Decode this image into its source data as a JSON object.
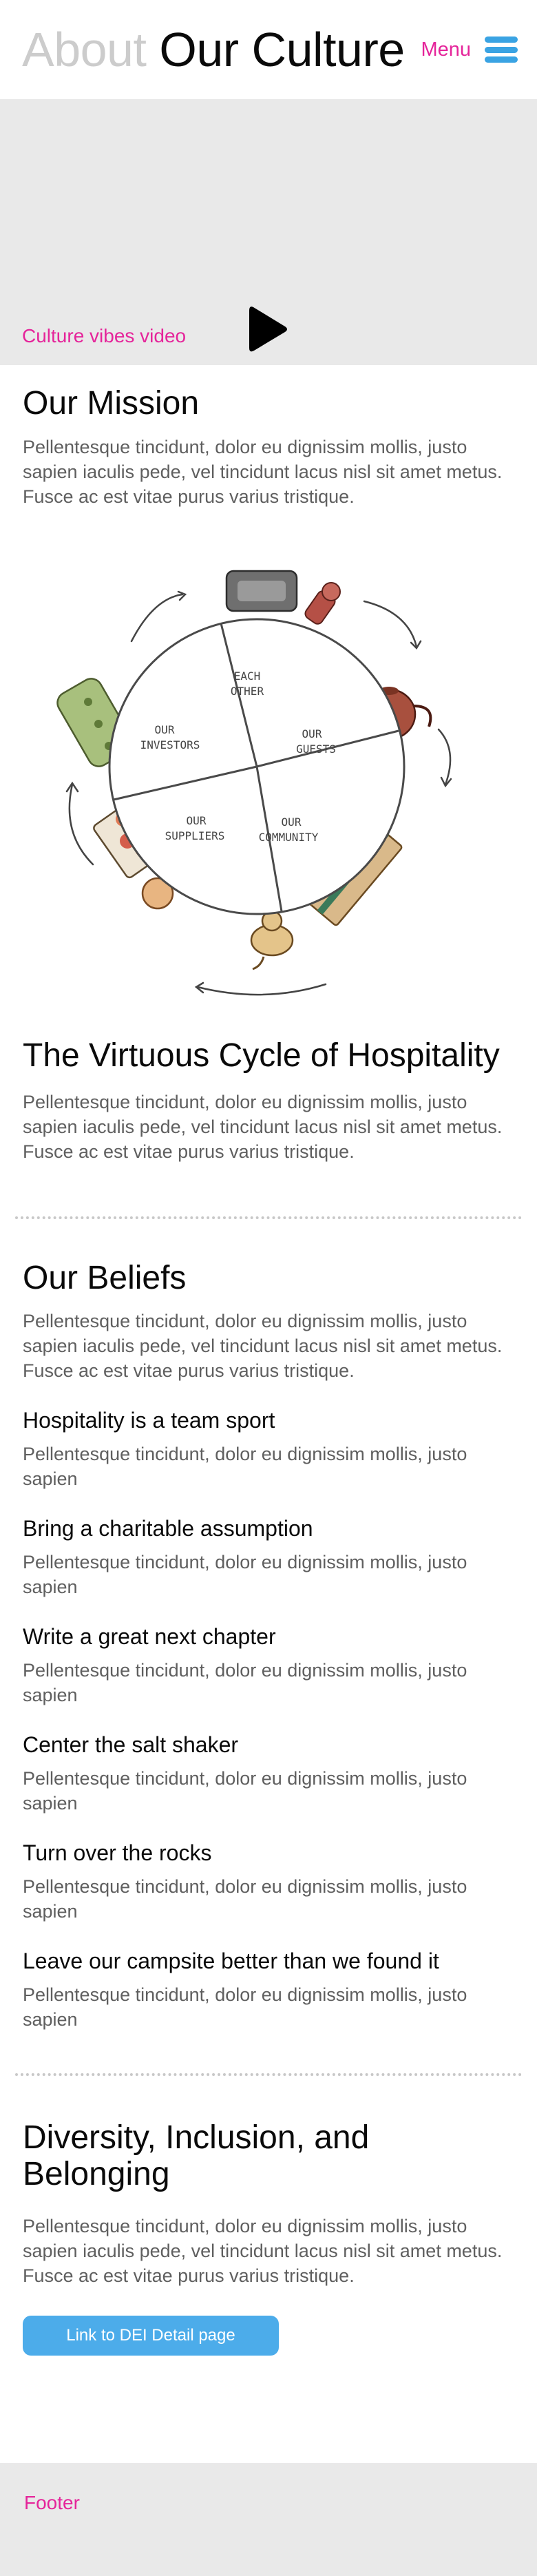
{
  "header": {
    "title_muted": "About",
    "title_strong": "Our Culture",
    "menu_label": "Menu"
  },
  "video": {
    "caption": "Culture vibes video",
    "icon": "play-icon"
  },
  "mission": {
    "title": "Our Mission",
    "body": "Pellentesque tincidunt, dolor eu dignissim mollis, justo sapien iaculis pede, vel tincidunt lacus nisl sit amet metus. Fusce ac est vitae purus varius tristique."
  },
  "wheel": {
    "segments": [
      {
        "line1": "EACH",
        "line2": "OTHER"
      },
      {
        "line1": "OUR",
        "line2": "GUESTS"
      },
      {
        "line1": "OUR",
        "line2": "COMMUNITY"
      },
      {
        "line1": "OUR",
        "line2": "SUPPLIERS"
      },
      {
        "line1": "OUR",
        "line2": "INVESTORS"
      }
    ]
  },
  "cycle": {
    "title": "The Virtuous Cycle of Hospitality",
    "body": "Pellentesque tincidunt, dolor eu dignissim mollis, justo sapien iaculis pede, vel tincidunt lacus nisl sit amet metus. Fusce ac est vitae purus varius tristique."
  },
  "beliefs": {
    "title": "Our Beliefs",
    "body": "Pellentesque tincidunt, dolor eu dignissim mollis, justo sapien iaculis pede, vel tincidunt lacus nisl sit amet metus. Fusce ac est vitae purus varius tristique.",
    "items": [
      {
        "title": "Hospitality is a team sport",
        "body": "Pellentesque tincidunt, dolor eu dignissim mollis, justo sapien"
      },
      {
        "title": "Bring a charitable assumption",
        "body": "Pellentesque tincidunt, dolor eu dignissim mollis, justo sapien"
      },
      {
        "title": "Write a great next chapter",
        "body": "Pellentesque tincidunt, dolor eu dignissim mollis, justo sapien"
      },
      {
        "title": "Center the salt shaker",
        "body": "Pellentesque tincidunt, dolor eu dignissim mollis, justo sapien"
      },
      {
        "title": "Turn over the rocks",
        "body": "Pellentesque tincidunt, dolor eu dignissim mollis, justo sapien"
      },
      {
        "title": "Leave our campsite better than we found it",
        "body": "Pellentesque tincidunt, dolor eu dignissim mollis, justo sapien"
      }
    ]
  },
  "dei": {
    "title": "Diversity, Inclusion, and Belonging",
    "body": "Pellentesque tincidunt, dolor eu dignissim mollis, justo sapien iaculis pede, vel tincidunt lacus nisl sit amet metus. Fusce ac est vitae purus varius tristique.",
    "button_label": "Link to DEI Detail page"
  },
  "footer": {
    "label": "Footer"
  },
  "colors": {
    "accent_pink": "#e5249a",
    "accent_blue": "#4cacea",
    "muted_gray": "#cccccc",
    "panel_gray": "#e9e9e9"
  }
}
